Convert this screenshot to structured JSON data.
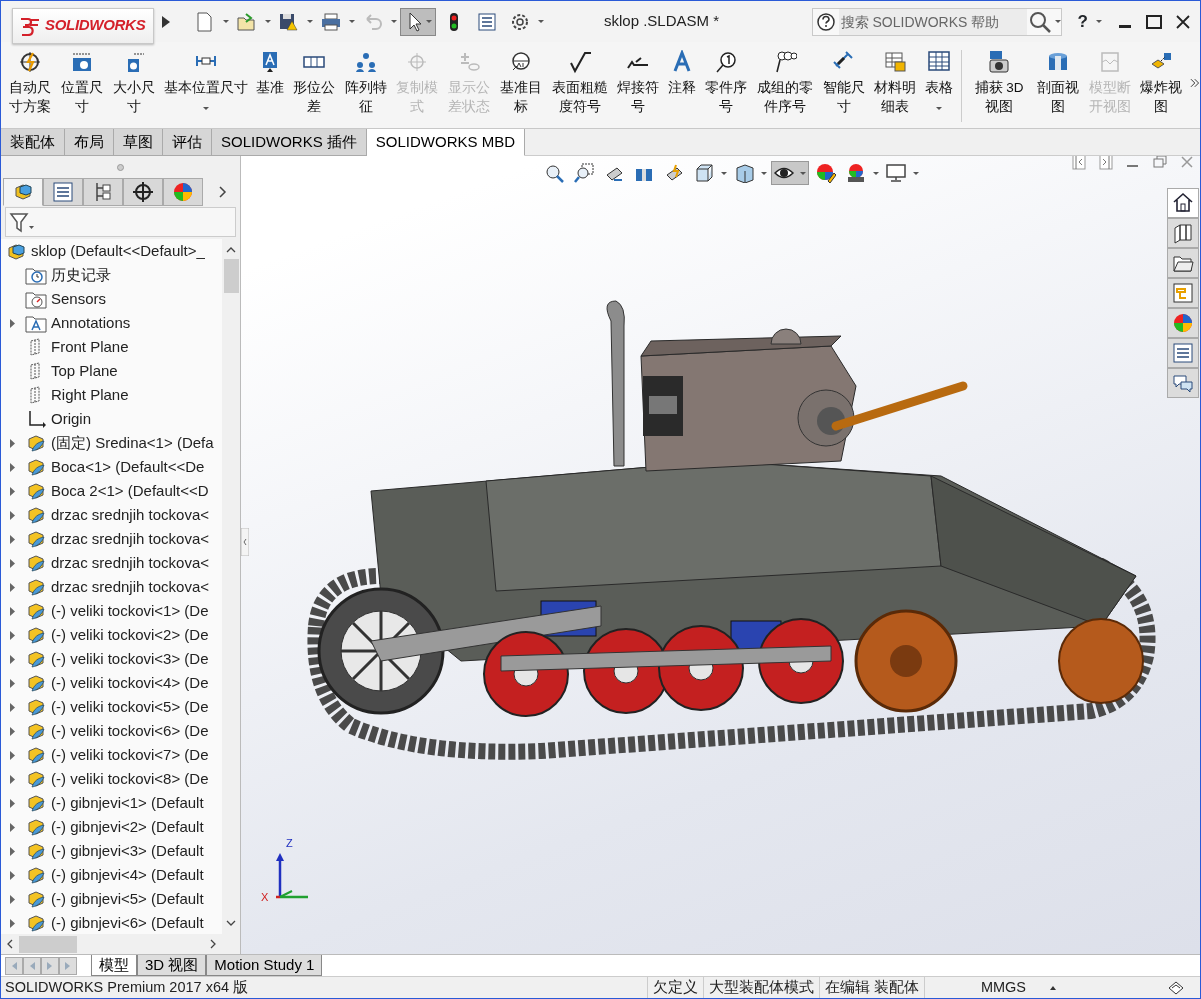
{
  "window": {
    "title": "sklop .SLDASM *",
    "logo_text": "SOLIDWORKS"
  },
  "quick_access": {
    "select_active": true
  },
  "search": {
    "placeholder": "搜索 SOLIDWORKS 帮助"
  },
  "help_label": "?",
  "ribbon": {
    "items": [
      {
        "label": "自动尺寸方案",
        "disabled": false,
        "has_menu": false
      },
      {
        "label": "位置尺寸",
        "disabled": false,
        "has_menu": false
      },
      {
        "label": "大小尺寸",
        "disabled": false,
        "has_menu": false
      },
      {
        "label": "基本位置尺寸",
        "disabled": false,
        "has_menu": true
      },
      {
        "label": "基准",
        "disabled": false,
        "has_menu": false
      },
      {
        "label": "形位公差",
        "disabled": false,
        "has_menu": false
      },
      {
        "label": "阵列特征",
        "disabled": false,
        "has_menu": false
      },
      {
        "label": "复制模式",
        "disabled": true,
        "has_menu": false
      },
      {
        "label": "显示公差状态",
        "disabled": true,
        "has_menu": false
      },
      {
        "label": "基准目标",
        "disabled": false,
        "has_menu": false
      },
      {
        "label": "表面粗糙度符号",
        "disabled": false,
        "has_menu": false
      },
      {
        "label": "焊接符号",
        "disabled": false,
        "has_menu": false
      },
      {
        "label": "注释",
        "disabled": false,
        "has_menu": false
      },
      {
        "label": "零件序号",
        "disabled": false,
        "has_menu": false
      },
      {
        "label": "成组的零件序号",
        "disabled": false,
        "has_menu": false
      },
      {
        "label": "智能尺寸",
        "disabled": false,
        "has_menu": false
      },
      {
        "label": "材料明细表",
        "disabled": false,
        "has_menu": false
      },
      {
        "label": "表格",
        "disabled": false,
        "has_menu": true
      },
      {
        "label": "捕获 3D视图",
        "disabled": false,
        "has_menu": false
      },
      {
        "label": "剖面视图",
        "disabled": false,
        "has_menu": false
      },
      {
        "label": "模型断开视图",
        "disabled": true,
        "has_menu": false
      },
      {
        "label": "爆炸视图",
        "disabled": false,
        "has_menu": false
      }
    ]
  },
  "tabs": [
    {
      "label": "装配体",
      "selected": false
    },
    {
      "label": "布局",
      "selected": false
    },
    {
      "label": "草图",
      "selected": false
    },
    {
      "label": "评估",
      "selected": false
    },
    {
      "label": "SOLIDWORKS 插件",
      "selected": false
    },
    {
      "label": "SOLIDWORKS MBD",
      "selected": true
    }
  ],
  "panel_tabs": [
    {
      "selected": true
    },
    {
      "selected": false
    },
    {
      "selected": false
    },
    {
      "selected": false
    },
    {
      "selected": false
    }
  ],
  "tree": {
    "root": "sklop  (Default<<Default>_",
    "items": [
      {
        "label": "历史记录",
        "kind": "history",
        "expandable": false
      },
      {
        "label": "Sensors",
        "kind": "sensors",
        "expandable": false
      },
      {
        "label": "Annotations",
        "kind": "annotations",
        "expandable": true
      },
      {
        "label": "Front Plane",
        "kind": "plane",
        "expandable": false
      },
      {
        "label": "Top Plane",
        "kind": "plane",
        "expandable": false
      },
      {
        "label": "Right Plane",
        "kind": "plane",
        "expandable": false
      },
      {
        "label": "Origin",
        "kind": "origin",
        "expandable": false
      },
      {
        "label": "(固定) Sredina<1> (Defa",
        "kind": "part",
        "expandable": true
      },
      {
        "label": "Boca<1> (Default<<De",
        "kind": "part",
        "expandable": true
      },
      {
        "label": "Boca 2<1> (Default<<D",
        "kind": "part",
        "expandable": true
      },
      {
        "label": "drzac srednjih tockova<",
        "kind": "part",
        "expandable": true
      },
      {
        "label": "drzac srednjih tockova<",
        "kind": "part",
        "expandable": true
      },
      {
        "label": "drzac srednjih tockova<",
        "kind": "part",
        "expandable": true
      },
      {
        "label": "drzac srednjih tockova<",
        "kind": "part",
        "expandable": true
      },
      {
        "label": "(-) veliki tockovi<1> (De",
        "kind": "part",
        "expandable": true
      },
      {
        "label": "(-) veliki tockovi<2> (De",
        "kind": "part",
        "expandable": true
      },
      {
        "label": "(-) veliki tockovi<3> (De",
        "kind": "part",
        "expandable": true
      },
      {
        "label": "(-) veliki tockovi<4> (De",
        "kind": "part",
        "expandable": true
      },
      {
        "label": "(-) veliki tockovi<5> (De",
        "kind": "part",
        "expandable": true
      },
      {
        "label": "(-) veliki tockovi<6> (De",
        "kind": "part",
        "expandable": true
      },
      {
        "label": "(-) veliki tockovi<7> (De",
        "kind": "part",
        "expandable": true
      },
      {
        "label": "(-) veliki tockovi<8> (De",
        "kind": "part",
        "expandable": true
      },
      {
        "label": "(-) gibnjevi<1> (Default",
        "kind": "part",
        "expandable": true
      },
      {
        "label": "(-) gibnjevi<2> (Default",
        "kind": "part",
        "expandable": true
      },
      {
        "label": "(-) gibnjevi<3> (Default",
        "kind": "part",
        "expandable": true
      },
      {
        "label": "(-) gibnjevi<4> (Default",
        "kind": "part",
        "expandable": true
      },
      {
        "label": "(-) gibnjevi<5> (Default",
        "kind": "part",
        "expandable": true
      },
      {
        "label": "(-) gibnjevi<6> (Default",
        "kind": "part",
        "expandable": true
      }
    ]
  },
  "view_toolbar": {
    "hide_show_active": true
  },
  "task_pane": [
    {
      "selected": true
    },
    {
      "selected": false
    },
    {
      "selected": false
    },
    {
      "selected": false
    },
    {
      "selected": false
    },
    {
      "selected": false
    },
    {
      "selected": false
    }
  ],
  "triad": {
    "z_label": "Z",
    "x_label": "X"
  },
  "bottom_tabs": [
    {
      "label": "模型",
      "selected": true
    },
    {
      "label": "3D 视图",
      "selected": false
    },
    {
      "label": "Motion Study 1",
      "selected": false
    }
  ],
  "status_bar": {
    "product": "SOLIDWORKS Premium 2017 x64 版",
    "fields": [
      "欠定义",
      "大型装配体模式",
      "在编辑 装配体"
    ],
    "units": "MMGS"
  }
}
